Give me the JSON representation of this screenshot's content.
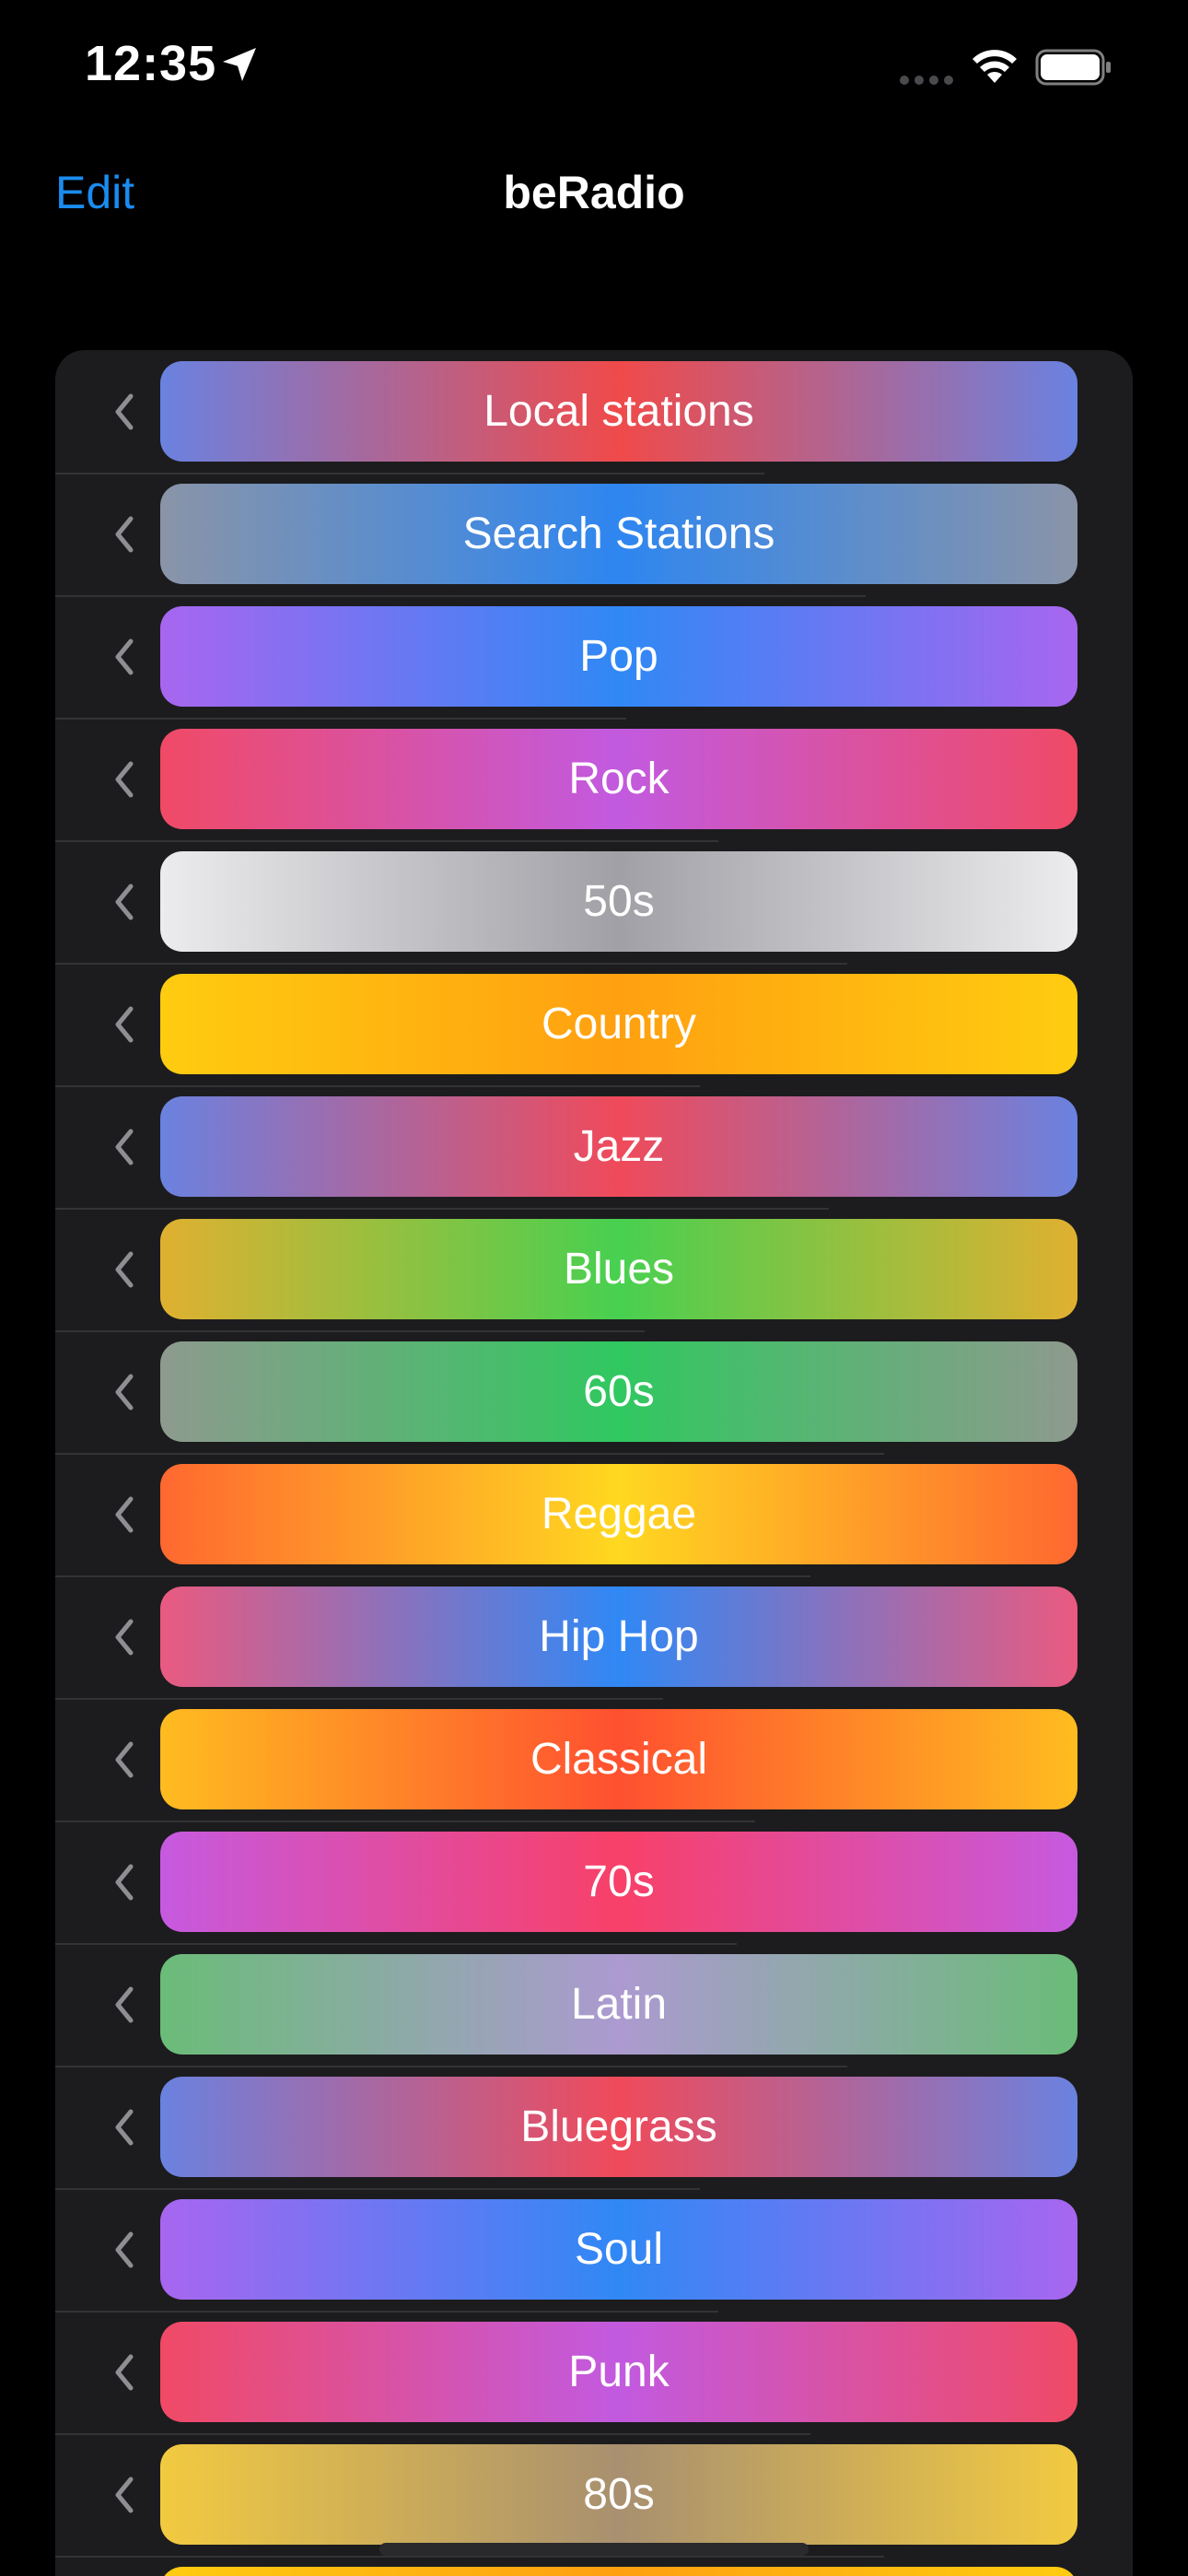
{
  "status_bar": {
    "time": "12:35",
    "icons": [
      "location-arrow-icon",
      "cellular-signal-icon",
      "wifi-icon",
      "battery-icon"
    ]
  },
  "nav": {
    "edit_label": "Edit",
    "title": "beRadio"
  },
  "colors": {
    "background": "#000000",
    "list_background": "#1c1c1e",
    "accent": "#1a8cf0",
    "chevron": "#8e8e93"
  },
  "rows": [
    {
      "label": "Local stations",
      "gradient": [
        "#6a82e0",
        "#f04a4a",
        "#6a82e0"
      ]
    },
    {
      "label": "Search Stations",
      "gradient": [
        "#8a94a8",
        "#2e86f0",
        "#8a94a8"
      ]
    },
    {
      "label": "Pop",
      "gradient": [
        "#a866f0",
        "#3088f5",
        "#a866f0"
      ]
    },
    {
      "label": "Rock",
      "gradient": [
        "#f04a66",
        "#c25ae0",
        "#f04a66"
      ]
    },
    {
      "label": "50s",
      "gradient": [
        "#ececee",
        "#a0a0a6",
        "#ececee"
      ]
    },
    {
      "label": "Country",
      "gradient": [
        "#ffcc10",
        "#ffa010",
        "#ffcc10"
      ]
    },
    {
      "label": "Jazz",
      "gradient": [
        "#6a82e0",
        "#f04a5a",
        "#6a82e0"
      ]
    },
    {
      "label": "Blues",
      "gradient": [
        "#e0b030",
        "#48d050",
        "#e0b030"
      ]
    },
    {
      "label": "60s",
      "gradient": [
        "#8e9a8e",
        "#30c860",
        "#8e9a8e"
      ]
    },
    {
      "label": "Reggae",
      "gradient": [
        "#ff6830",
        "#ffd820",
        "#ff6830"
      ]
    },
    {
      "label": "Hip Hop",
      "gradient": [
        "#ea5a80",
        "#3088f5",
        "#ea5a80"
      ]
    },
    {
      "label": "Classical",
      "gradient": [
        "#ffbc20",
        "#ff5030",
        "#ffbc20"
      ]
    },
    {
      "label": "70s",
      "gradient": [
        "#c65ae0",
        "#f84068",
        "#c65ae0"
      ]
    },
    {
      "label": "Latin",
      "gradient": [
        "#6abc78",
        "#ac9ad0",
        "#6abc78"
      ]
    },
    {
      "label": "Bluegrass",
      "gradient": [
        "#6a82e0",
        "#f04a5a",
        "#6a82e0"
      ]
    },
    {
      "label": "Soul",
      "gradient": [
        "#a866f0",
        "#3088f5",
        "#a866f0"
      ]
    },
    {
      "label": "Punk",
      "gradient": [
        "#f04a66",
        "#c25ae0",
        "#f04a66"
      ]
    },
    {
      "label": "80s",
      "gradient": [
        "#f2ca40",
        "#a89070",
        "#f2ca40"
      ]
    },
    {
      "label": "",
      "gradient": [
        "#ffcc10",
        "#ffa010",
        "#ffcc10"
      ]
    }
  ]
}
